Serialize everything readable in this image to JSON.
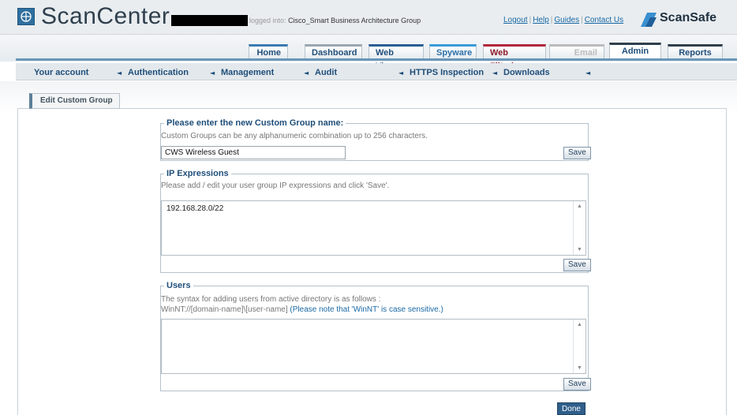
{
  "header": {
    "app_title": "ScanCenter",
    "logged_label": "logged into:",
    "logged_value": "Cisco_Smart Business Architecture Group",
    "links": [
      "Logout",
      "Help",
      "Guides",
      "Contact Us"
    ],
    "brand": "ScanSafe"
  },
  "main_nav": {
    "tabs": [
      "Home",
      "Dashboard",
      "Web Virus",
      "Spyware",
      "Web Filtering",
      "Email",
      "Admin",
      "Reports"
    ],
    "active": "Admin"
  },
  "sub_nav": {
    "items": [
      "Your account",
      "Authentication",
      "Management",
      "Audit",
      "HTTPS Inspection",
      "Downloads"
    ]
  },
  "panel": {
    "tab_label": "Edit Custom Group"
  },
  "group_name": {
    "legend": "Please enter the new Custom Group name:",
    "description": "Custom Groups can be any alphanumeric combination up to 256 characters.",
    "value": "CWS Wireless Guest",
    "save_label": "Save"
  },
  "ip_expressions": {
    "legend": "IP Expressions",
    "description": "Please add / edit your user group IP expressions and click 'Save'.",
    "value": "192.168.28.0/22",
    "save_label": "Save"
  },
  "users": {
    "legend": "Users",
    "description_line1": "The syntax for adding users from active directory is as follows :",
    "syntax": "WinNT://[domain-name]\\[user-name]",
    "note": "(Please note that 'WinNT' is case sensitive.)",
    "value": "",
    "save_label": "Save"
  },
  "done_label": "Done",
  "colors": {
    "nav_text": "#1f4e79",
    "link": "#1a69a4",
    "done_button": "#2f5e8a",
    "web_filtering_accent": "#b0283a"
  }
}
